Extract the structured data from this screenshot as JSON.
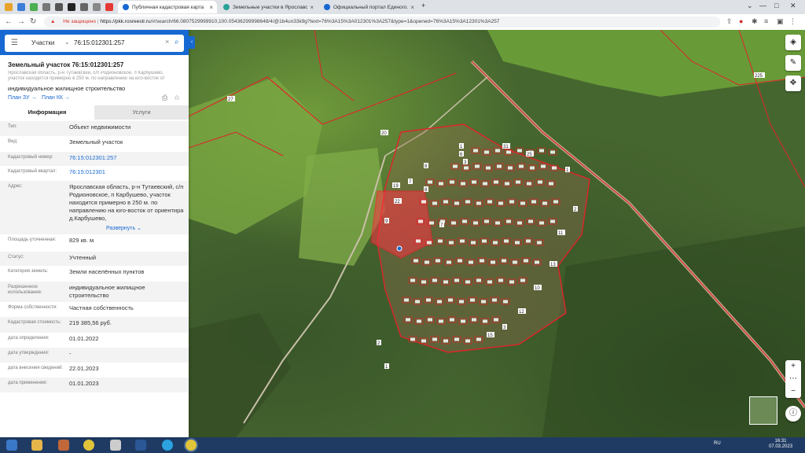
{
  "browser": {
    "tabs": [
      {
        "label": "Публичная кадастровая карта",
        "active": true
      },
      {
        "label": "Земельные участки в Ярославск...",
        "active": false
      },
      {
        "label": "Официальный портал Единого...",
        "active": false
      }
    ],
    "address": {
      "warning": "Не защищено",
      "domain": "https://pkk.rosreestr.ru",
      "path": "/#/search/66.0807529999910,100.05436299998648/4/@1b4un33k9g?text=76%3A15%3A012301%3A257&type=1&opened=76%3A15%3A12301%3A257"
    }
  },
  "search": {
    "category": "Участки",
    "value": "76:15:012301:257"
  },
  "object": {
    "title": "Земельный участок 76:15:012301:257",
    "address": "Ярославская область, р-н Тутаевский, с/п Родионовское, п Карбушево, участок находится примерно в 250 м. по направлению на юго-восток от ориентира д.Карбушево",
    "use": "индивидуальное жилищное строительство",
    "plan_zu": "План ЗУ →",
    "plan_kk": "План КК →"
  },
  "tabs": {
    "info": "Информация",
    "services": "Услуги"
  },
  "rows": [
    {
      "label": "Тип:",
      "value": "Объект недвижимости"
    },
    {
      "label": "Вид:",
      "value": "Земельный участок"
    },
    {
      "label": "Кадастровый номер:",
      "value": "76:15:012301:257"
    },
    {
      "label": "Кадастровый квартал:",
      "value": "76:15:012301"
    },
    {
      "label": "Адрес:",
      "value": "Ярославская область, р-н Тутаевский, с/п Родионовское, п Карбушево, участок находится примерно в 250 м. по направлению на юго-восток от ориентира д.Карбушево,"
    },
    {
      "label": "Площадь уточненная:",
      "value": "829 кв. м"
    },
    {
      "label": "Статус:",
      "value": "Учтенный"
    },
    {
      "label": "Категория земель:",
      "value": "Земли населённых пунктов"
    },
    {
      "label": "Разрешенное использование:",
      "value": "индивидуальное жилищное строительство"
    },
    {
      "label": "Форма собственности:",
      "value": "Частная собственность"
    },
    {
      "label": "Кадастровая стоимость:",
      "value": "219 385,56 руб."
    },
    {
      "label": "дата определения:",
      "value": "01.01.2022"
    },
    {
      "label": "дата утверждения:",
      "value": "-"
    },
    {
      "label": "дата внесения сведений:",
      "value": "22.01.2023"
    },
    {
      "label": "дата применения:",
      "value": "01.01.2023"
    }
  ],
  "expand_label": "Развернуть ⌄",
  "map": {
    "labels": [
      "20",
      "22",
      "1",
      "6",
      "7",
      "8",
      "19",
      "31",
      "25",
      "9",
      "7",
      "1",
      "2",
      "11",
      "13",
      "10",
      "12",
      "3",
      "15",
      "2",
      "1",
      "3",
      "8",
      "27",
      "225"
    ]
  },
  "taskbar": {
    "lang": "RU",
    "time": "16:31",
    "date": "07.03.2023"
  },
  "colors": {
    "accent": "#1768d2",
    "boundary": "#e0242a",
    "selected": "#ff3344"
  }
}
